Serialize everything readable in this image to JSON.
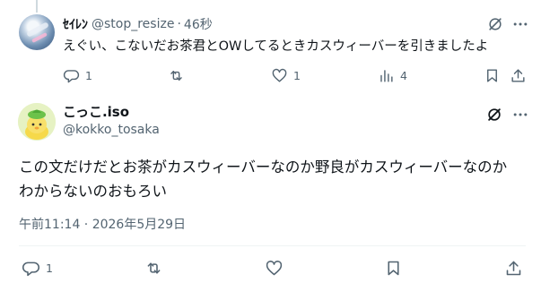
{
  "reply": {
    "display_name": "ｾｲﾚﾝ",
    "handle": "@stop_resize",
    "separator": "·",
    "time": "46秒",
    "text": "えぐい、こないだお茶君とOWしてるときカスウィーバーを引きましたよ",
    "reply_count": "1",
    "retweet_count": "",
    "like_count": "1",
    "view_count": "4"
  },
  "main": {
    "display_name": "こっこ.iso",
    "handle": "@kokko_tosaka",
    "text_line1": "この文だけだとお茶がカスウィーバーなのか野良がカスウィーバーなのか",
    "text_line2": "わからないのおもろい",
    "timestamp": "午前11:14 · 2026年5月29日",
    "reply_count": "1"
  },
  "icons": {
    "grok": "grok-icon",
    "more": "more-icon",
    "reply": "reply-icon",
    "retweet": "retweet-icon",
    "like": "like-icon",
    "views": "views-icon",
    "bookmark": "bookmark-icon",
    "share": "share-icon"
  },
  "colors": {
    "text": "#0f1419",
    "secondary": "#536471",
    "divider": "#eff3f4",
    "thread_line": "#cfd9de"
  }
}
